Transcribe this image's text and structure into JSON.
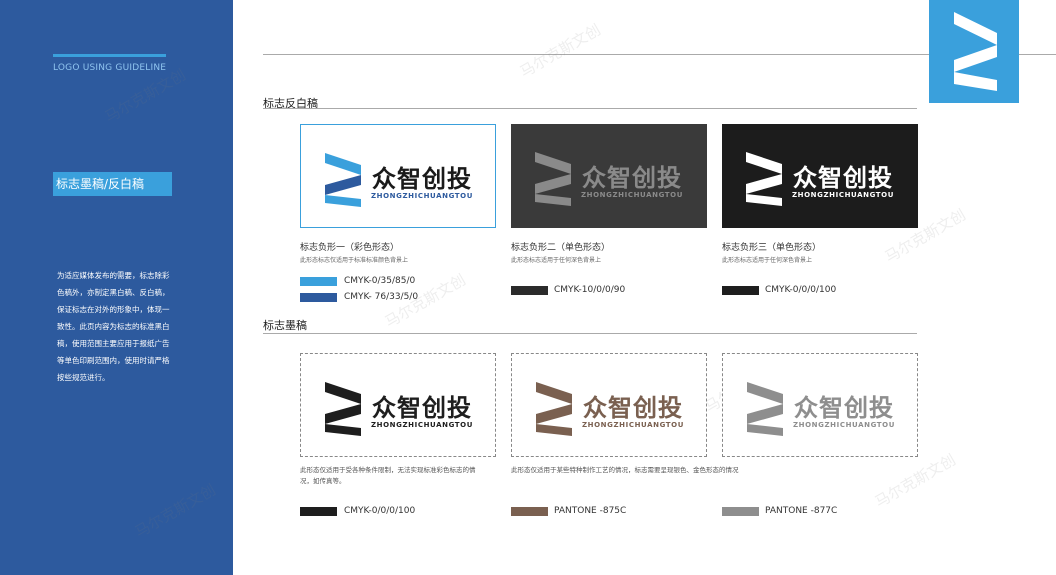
{
  "sidebar": {
    "guide": "LOGO USING GUIDELINE",
    "title": "标志墨稿/反白稿",
    "description": "为适应媒体发布的需要，标志除彩色稿外，亦制定黑白稿、反白稿，保证标志在对外的形象中，体现一致性。此页内容为标志的标准黑白稿，使用范围主要应用于报纸广告等单色印刷范围内，使用时请严格按些规范进行。"
  },
  "logo": {
    "cn": "众智创投",
    "en": "ZHONGZHICHUANGTOU"
  },
  "section_reverse": {
    "title": "标志反白稿",
    "items": [
      {
        "caption": "标志负形一（彩色形态）",
        "subcaption": "此形态标志仅适用于标准标准颜色背景上",
        "swatches": [
          {
            "color": "#3aa0dc",
            "label": "CMYK-0/35/85/0"
          },
          {
            "color": "#2d5a9e",
            "label": "CMYK- 76/33/5/0"
          }
        ]
      },
      {
        "caption": "标志负形二（单色形态）",
        "subcaption": "此形态标志适用于任何深色背景上",
        "swatches": [
          {
            "color": "#2b2b2b",
            "label": "CMYK-10/0/0/90"
          }
        ]
      },
      {
        "caption": "标志负形三（单色形态）",
        "subcaption": "此形态标志适用于任何深色背景上",
        "swatches": [
          {
            "color": "#1e1e1e",
            "label": "CMYK-0/0/0/100"
          }
        ]
      }
    ]
  },
  "section_ink": {
    "title": "标志墨稿",
    "note1": "此形态仅适用于受各种条件限制，无法实现标准彩色标志的情况，如传真等。",
    "note2": "此形态仅适用于某些特种制作工艺的情况，标志需要呈现银色、金色形态的情况",
    "swatches": [
      {
        "color": "#1e1e1e",
        "label": "CMYK-0/0/0/100"
      },
      {
        "color": "#7a6050",
        "label": "PANTONE -875C"
      },
      {
        "color": "#8e8e8e",
        "label": "PANTONE -877C"
      }
    ]
  },
  "watermark": "马尔克斯文创",
  "colors": {
    "sidebar": "#2d5a9e",
    "accent": "#3aa0dc"
  }
}
